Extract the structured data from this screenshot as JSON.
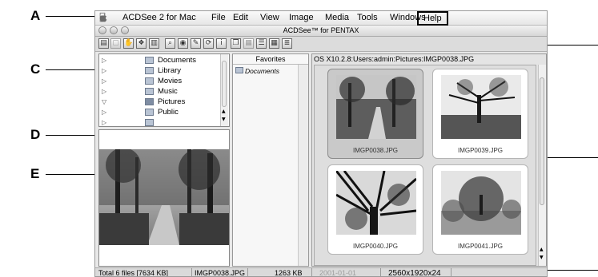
{
  "callouts": {
    "a": "A",
    "c": "C",
    "d": "D",
    "e": "E"
  },
  "menubar": {
    "apple_icon": "apple-icon",
    "app_name": "ACDSee 2 for Mac",
    "items": [
      "File",
      "Edit",
      "View",
      "Image",
      "Media",
      "Tools",
      "Windows",
      "Help"
    ]
  },
  "window": {
    "title": "ACDSee™ for PENTAX"
  },
  "folders": {
    "items": [
      {
        "label": "Documents",
        "expanded": false
      },
      {
        "label": "Library",
        "expanded": false
      },
      {
        "label": "Movies",
        "expanded": false
      },
      {
        "label": "Music",
        "expanded": false
      },
      {
        "label": "Pictures",
        "expanded": true
      },
      {
        "label": "Public",
        "expanded": false
      }
    ]
  },
  "favorites": {
    "header": "Favorites",
    "items": [
      "Documents"
    ]
  },
  "path": {
    "text": "OS X10.2.8:Users:admin:Pictures:IMGP0038.JPG"
  },
  "thumbnails": [
    {
      "caption": "IMGP0038.JPG",
      "selected": true
    },
    {
      "caption": "IMGP0039.JPG",
      "selected": false
    },
    {
      "caption": "IMGP0040.JPG",
      "selected": false
    },
    {
      "caption": "IMGP0041.JPG",
      "selected": false
    }
  ],
  "status": {
    "total": "Total 6 files [7634 KB]",
    "filename": "IMGP0038.JPG",
    "size": "1263 KB",
    "date": "2001-01-01",
    "dimensions": "2560x1920x24"
  },
  "colors": {
    "help_highlight_border": "#000000"
  }
}
